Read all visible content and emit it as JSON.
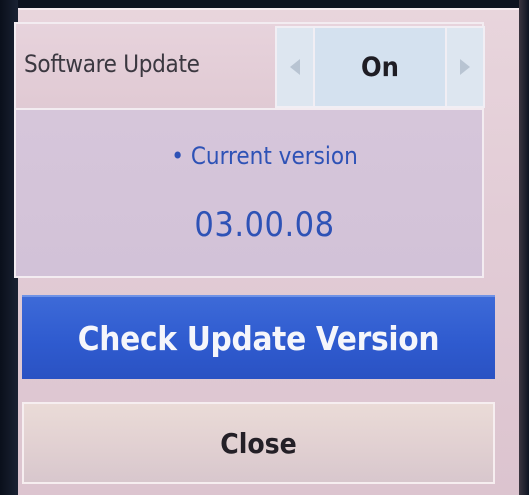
{
  "software_update": {
    "label": "Software Update",
    "value": "On",
    "left_arrow_icon": "arrow-left-icon",
    "right_arrow_icon": "arrow-right-icon"
  },
  "version": {
    "label": "• Current version",
    "value": "03.00.08"
  },
  "buttons": {
    "check_update": "Check Update Version",
    "close": "Close"
  },
  "colors": {
    "accent": "#2f5bcf",
    "version_text": "#2e52b6",
    "panel": "#e4cfd9"
  }
}
